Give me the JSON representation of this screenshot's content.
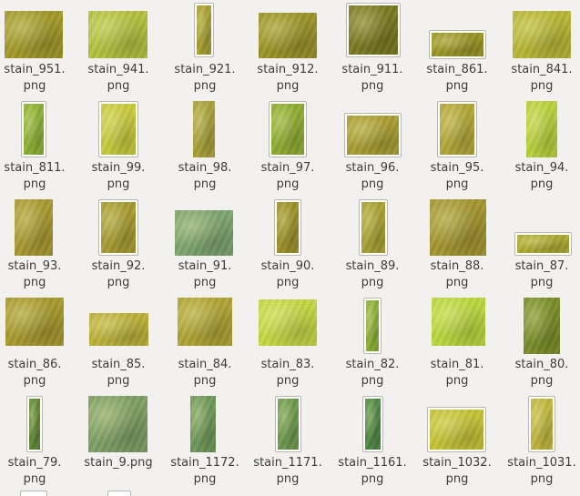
{
  "files": [
    {
      "line1": "stain_951.",
      "line2": "png",
      "color": "#a39a2a",
      "framed": false
    },
    {
      "line1": "stain_941.",
      "line2": "png",
      "color": "#b4c23f",
      "framed": false
    },
    {
      "line1": "stain_921.",
      "line2": "png",
      "color": "#a8a030",
      "framed": true
    },
    {
      "line1": "stain_912.",
      "line2": "png",
      "color": "#9c9428",
      "framed": false
    },
    {
      "line1": "stain_911.",
      "line2": "png",
      "color": "#7a7a22",
      "framed": true
    },
    {
      "line1": "stain_861.",
      "line2": "png",
      "color": "#9a9626",
      "framed": true
    },
    {
      "line1": "stain_841.",
      "line2": "png",
      "color": "#b8b836",
      "framed": false
    },
    {
      "line1": "stain_811.",
      "line2": "png",
      "color": "#8cb332",
      "framed": true
    },
    {
      "line1": "stain_99.",
      "line2": "png",
      "color": "#c8cc3c",
      "framed": true
    },
    {
      "line1": "stain_98.",
      "line2": "png",
      "color": "#a9a23a",
      "framed": false
    },
    {
      "line1": "stain_97.",
      "line2": "png",
      "color": "#8fae30",
      "framed": true
    },
    {
      "line1": "stain_96.",
      "line2": "png",
      "color": "#aa9e32",
      "framed": true
    },
    {
      "line1": "stain_95.",
      "line2": "png",
      "color": "#b4a838",
      "framed": true
    },
    {
      "line1": "stain_94.",
      "line2": "png",
      "color": "#b9d23c",
      "framed": false
    },
    {
      "line1": "stain_93.",
      "line2": "png",
      "color": "#a99a30",
      "framed": false
    },
    {
      "line1": "stain_92.",
      "line2": "png",
      "color": "#a89c30",
      "framed": true
    },
    {
      "line1": "stain_91.",
      "line2": "png",
      "color": "#7da56f",
      "framed": false
    },
    {
      "line1": "stain_90.",
      "line2": "png",
      "color": "#9e9228",
      "framed": true
    },
    {
      "line1": "stain_89.",
      "line2": "png",
      "color": "#aaa232",
      "framed": true
    },
    {
      "line1": "stain_88.",
      "line2": "png",
      "color": "#a49630",
      "framed": false
    },
    {
      "line1": "stain_87.",
      "line2": "png",
      "color": "#aeaa30",
      "framed": true
    },
    {
      "line1": "stain_86.",
      "line2": "png",
      "color": "#a89a2e",
      "framed": false
    },
    {
      "line1": "stain_85.",
      "line2": "png",
      "color": "#bcb23a",
      "framed": false
    },
    {
      "line1": "stain_84.",
      "line2": "png",
      "color": "#b0a434",
      "framed": false
    },
    {
      "line1": "stain_83.",
      "line2": "png",
      "color": "#c6d844",
      "framed": false
    },
    {
      "line1": "stain_82.",
      "line2": "png",
      "color": "#8bb236",
      "framed": true
    },
    {
      "line1": "stain_81.",
      "line2": "png",
      "color": "#bcd83e",
      "framed": false
    },
    {
      "line1": "stain_80.",
      "line2": "png",
      "color": "#7b8e28",
      "framed": false
    },
    {
      "line1": "stain_79.",
      "line2": "png",
      "color": "#5f8a32",
      "framed": true
    },
    {
      "line1": "stain_9.png",
      "line2": "",
      "color": "#7ea064",
      "framed": false
    },
    {
      "line1": "stain_1172.",
      "line2": "png",
      "color": "#6f9a5a",
      "framed": false
    },
    {
      "line1": "stain_1171.",
      "line2": "png",
      "color": "#6c9c4e",
      "framed": true
    },
    {
      "line1": "stain_1161.",
      "line2": "png",
      "color": "#4e8a44",
      "framed": true
    },
    {
      "line1": "stain_1032.",
      "line2": "png",
      "color": "#c6c436",
      "framed": true
    },
    {
      "line1": "stain_1031.",
      "line2": "png",
      "color": "#c2b83c",
      "framed": true
    }
  ]
}
